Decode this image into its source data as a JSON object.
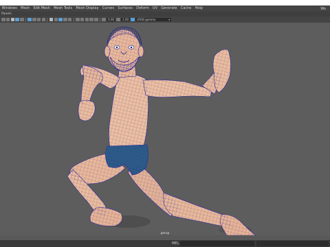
{
  "menubar": {
    "items": [
      "Windows",
      "Mesh",
      "Edit Mesh",
      "Mesh Tools",
      "Mesh Display",
      "Curves",
      "Surfaces",
      "Deform",
      "UV",
      "Generate",
      "Cache",
      "Help"
    ],
    "right_label": "Wo"
  },
  "panels": {
    "label": "Panels"
  },
  "toolbar": {
    "field_a": "0.00",
    "field_b": "1.00",
    "colorspace": "sRGB gamma"
  },
  "viewport": {
    "camera_label": "persp"
  },
  "statusbar": {
    "command_label": "MEL"
  },
  "colors": {
    "viewport_bg": "#5d5d5d",
    "skin": "#ecbfa0",
    "wire": "#2a2aa0",
    "shorts": "#2b5c86",
    "accent": "#5aa0d8"
  }
}
